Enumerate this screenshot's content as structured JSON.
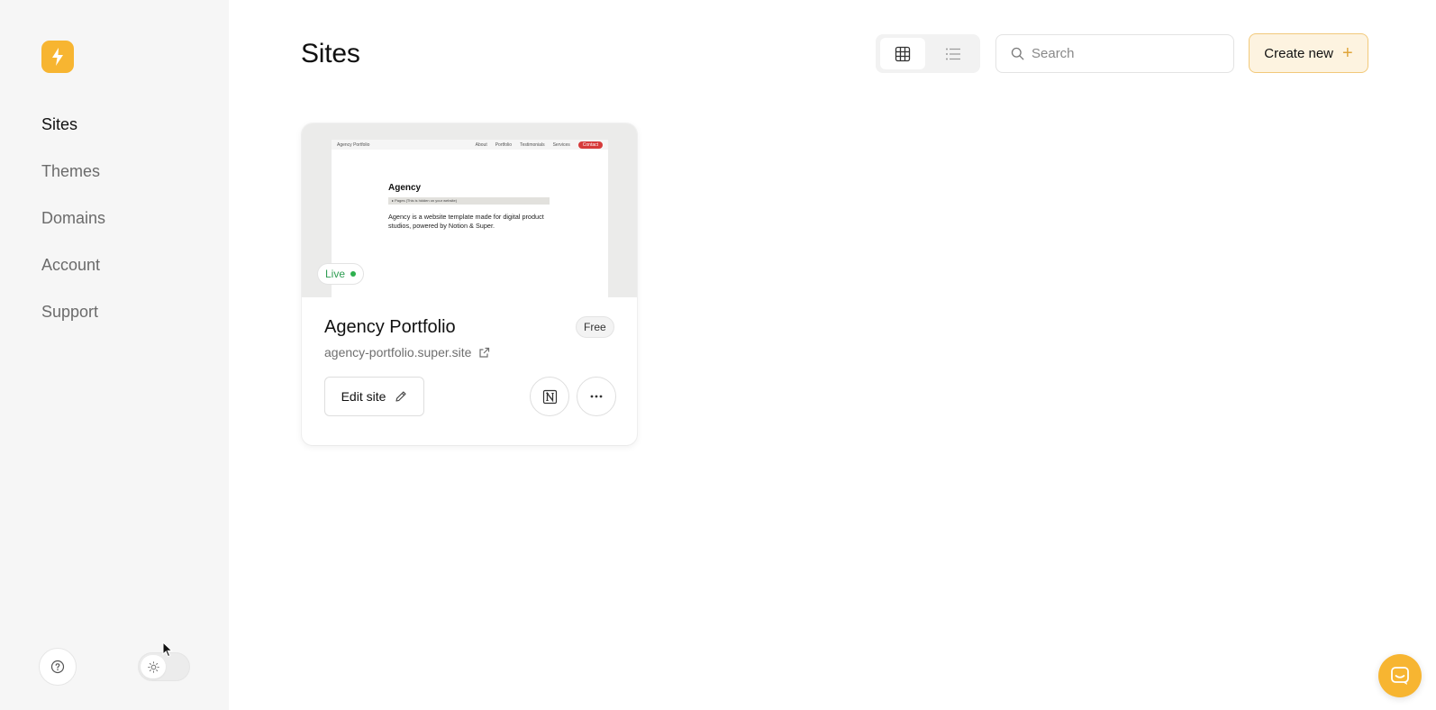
{
  "sidebar": {
    "logo": "bolt-icon",
    "items": [
      {
        "label": "Sites",
        "active": true
      },
      {
        "label": "Themes",
        "active": false
      },
      {
        "label": "Domains",
        "active": false
      },
      {
        "label": "Account",
        "active": false
      },
      {
        "label": "Support",
        "active": false
      }
    ],
    "help_icon": "question-circle-icon",
    "theme_icon": "sun-icon"
  },
  "header": {
    "title": "Sites",
    "view_options": [
      "grid-icon",
      "list-icon"
    ],
    "active_view": "grid",
    "search": {
      "placeholder": "Search",
      "value": ""
    },
    "create_label": "Create new"
  },
  "sites": [
    {
      "name": "Agency Portfolio",
      "plan": "Free",
      "status": "Live",
      "url": "agency-portfolio.super.site",
      "edit_label": "Edit site",
      "preview": {
        "brand": "Agency Portfolio",
        "nav": [
          "About",
          "Portfolio",
          "Testimonials",
          "Services"
        ],
        "nav_cta": "Contact",
        "title": "Agency",
        "toggle_text": "▸ Pages (This is hidden on your website)",
        "body": "Agency is a website template made for digital product studios, powered by Notion & Super."
      }
    }
  ],
  "colors": {
    "accent": "#f7b531",
    "live": "#2eb04f",
    "sidebar_bg": "#f6f6f6"
  }
}
